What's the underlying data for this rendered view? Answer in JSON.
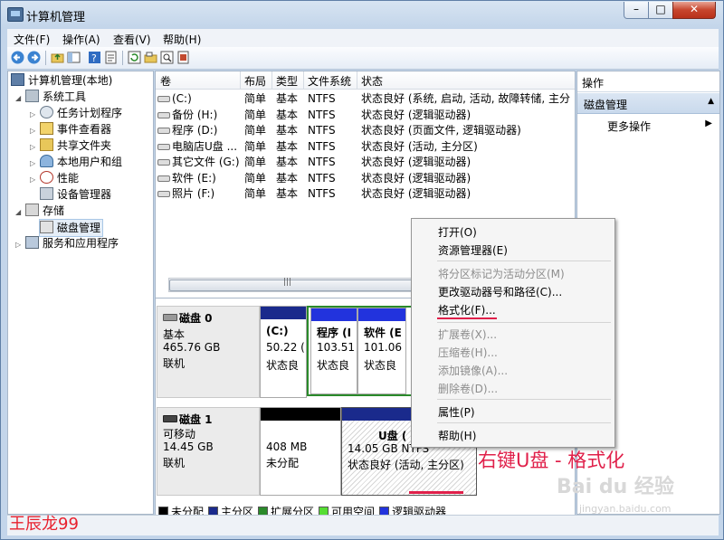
{
  "window": {
    "title": "计算机管理"
  },
  "menubar": [
    {
      "label": "文件(F)"
    },
    {
      "label": "操作(A)"
    },
    {
      "label": "查看(V)"
    },
    {
      "label": "帮助(H)"
    }
  ],
  "toolbar_icons": [
    "back-arrow-icon",
    "forward-arrow-icon",
    "up-folder-icon",
    "show-hide-tree-icon",
    "help-icon",
    "properties-icon",
    "refresh-icon",
    "open-icon",
    "search-icon",
    "export-icon"
  ],
  "tree": {
    "items": [
      {
        "label": "计算机管理(本地)",
        "level": 0,
        "icon": "computer-management-icon"
      },
      {
        "label": "系统工具",
        "level": 1,
        "icon": "system-tools-icon",
        "expanded": true
      },
      {
        "label": "任务计划程序",
        "level": 2,
        "icon": "task-scheduler-icon"
      },
      {
        "label": "事件查看器",
        "level": 2,
        "icon": "event-viewer-icon"
      },
      {
        "label": "共享文件夹",
        "level": 2,
        "icon": "shared-folders-icon"
      },
      {
        "label": "本地用户和组",
        "level": 2,
        "icon": "local-users-icon"
      },
      {
        "label": "性能",
        "level": 2,
        "icon": "performance-icon"
      },
      {
        "label": "设备管理器",
        "level": 2,
        "icon": "device-manager-icon"
      },
      {
        "label": "存储",
        "level": 1,
        "icon": "storage-icon",
        "expanded": true
      },
      {
        "label": "磁盘管理",
        "level": 2,
        "icon": "disk-management-icon",
        "selected": true
      },
      {
        "label": "服务和应用程序",
        "level": 1,
        "icon": "services-apps-icon"
      }
    ]
  },
  "volumes": {
    "headers": [
      "卷",
      "布局",
      "类型",
      "文件系统",
      "状态"
    ],
    "rows": [
      {
        "name": "(C:)",
        "layout": "简单",
        "type": "基本",
        "fs": "NTFS",
        "status": "状态良好 (系统, 启动, 活动, 故障转储, 主分"
      },
      {
        "name": "备份 (H:)",
        "layout": "简单",
        "type": "基本",
        "fs": "NTFS",
        "status": "状态良好 (逻辑驱动器)"
      },
      {
        "name": "程序 (D:)",
        "layout": "简单",
        "type": "基本",
        "fs": "NTFS",
        "status": "状态良好 (页面文件, 逻辑驱动器)"
      },
      {
        "name": "电脑店U盘 ...",
        "layout": "简单",
        "type": "基本",
        "fs": "NTFS",
        "status": "状态良好 (活动, 主分区)"
      },
      {
        "name": "其它文件 (G:)",
        "layout": "简单",
        "type": "基本",
        "fs": "NTFS",
        "status": "状态良好 (逻辑驱动器)"
      },
      {
        "name": "软件 (E:)",
        "layout": "简单",
        "type": "基本",
        "fs": "NTFS",
        "status": "状态良好 (逻辑驱动器)"
      },
      {
        "name": "照片 (F:)",
        "layout": "简单",
        "type": "基本",
        "fs": "NTFS",
        "status": "状态良好 (逻辑驱动器)"
      }
    ]
  },
  "disks": {
    "disk0": {
      "name": "磁盘 0",
      "kind": "基本",
      "size": "465.76 GB",
      "state": "联机",
      "parts": [
        {
          "title": "(C:)",
          "size": "50.22 (",
          "status": "状态良"
        },
        {
          "title": "程序 (I",
          "size": "103.51",
          "status": "状态良"
        },
        {
          "title": "软件 (E",
          "size": "101.06",
          "status": "状态良"
        }
      ]
    },
    "disk1": {
      "name": "磁盘 1",
      "kind": "可移动",
      "size": "14.45 GB",
      "state": "联机",
      "parts": [
        {
          "title": "",
          "size": "408 MB",
          "status": "未分配"
        },
        {
          "title": "U盘 (",
          "size": "14.05 GB NTFS",
          "status": "状态良好 (活动, 主分区)"
        }
      ]
    }
  },
  "legend": [
    {
      "label": "未分配",
      "color": "#000000"
    },
    {
      "label": "主分区",
      "color": "#1a2a8c"
    },
    {
      "label": "扩展分区",
      "color": "#2a8a2a"
    },
    {
      "label": "可用空间",
      "color": "#55dd33"
    },
    {
      "label": "逻辑驱动器",
      "color": "#2233dd"
    }
  ],
  "actions": {
    "header": "操作",
    "section": "磁盘管理",
    "more": "更多操作"
  },
  "context_menu": [
    {
      "label": "打开(O)",
      "enabled": true
    },
    {
      "label": "资源管理器(E)",
      "enabled": true
    },
    {
      "label": "将分区标记为活动分区(M)",
      "enabled": false
    },
    {
      "label": "更改驱动器号和路径(C)...",
      "enabled": true
    },
    {
      "label": "格式化(F)...",
      "enabled": true
    },
    {
      "label": "扩展卷(X)...",
      "enabled": false
    },
    {
      "label": "压缩卷(H)...",
      "enabled": false
    },
    {
      "label": "添加镜像(A)...",
      "enabled": false
    },
    {
      "label": "删除卷(D)...",
      "enabled": false
    },
    {
      "label": "属性(P)",
      "enabled": true
    },
    {
      "label": "帮助(H)",
      "enabled": true
    }
  ],
  "annotation": "右键U盘 - 格式化",
  "watermark": "王辰龙99",
  "baidu_mark": "Bai du 经验",
  "baidu_url": "jingyan.baidu.com",
  "colors": {
    "accent_red": "#e0204a",
    "selection": "#e5eef8"
  }
}
